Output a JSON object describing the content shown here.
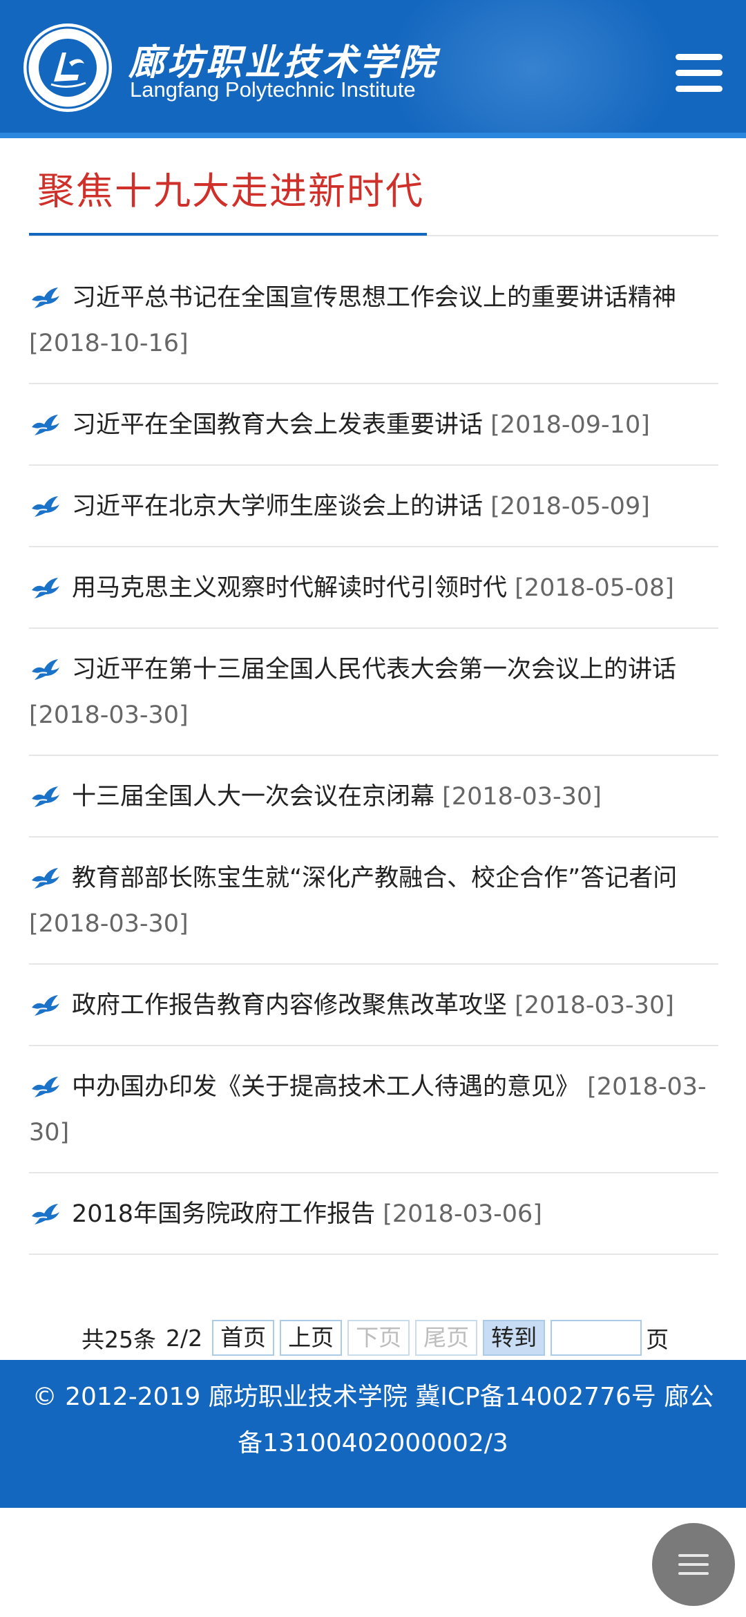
{
  "header": {
    "logo_cn": "廊坊职业技术学院",
    "logo_en": "Langfang Polytechnic Institute",
    "seal_text": "廊坊职业技术学院 Langfang Polytechnic Institute",
    "menu_icon": "hamburger-menu-icon"
  },
  "section": {
    "title": "聚焦十九大走进新时代"
  },
  "news": [
    {
      "title": "习近平总书记在全国宣传思想工作会议上的重要讲话精神",
      "date": "[2018-10-16]"
    },
    {
      "title": "习近平在全国教育大会上发表重要讲话",
      "date": "[2018-09-10]"
    },
    {
      "title": "习近平在北京大学师生座谈会上的讲话",
      "date": "[2018-05-09]"
    },
    {
      "title": "用马克思主义观察时代解读时代引领时代",
      "date": "[2018-05-08]"
    },
    {
      "title": "习近平在第十三届全国人民代表大会第一次会议上的讲话",
      "date": "[2018-03-30]"
    },
    {
      "title": "十三届全国人大一次会议在京闭幕",
      "date": "[2018-03-30]"
    },
    {
      "title": "教育部部长陈宝生就“深化产教融合、校企合作”答记者问",
      "date": "[2018-03-30]"
    },
    {
      "title": "政府工作报告教育内容修改聚焦改革攻坚",
      "date": "[2018-03-30]"
    },
    {
      "title": "中办国办印发《关于提高技术工人待遇的意见》",
      "date": "[2018-03-30]"
    },
    {
      "title": "2018年国务院政府工作报告",
      "date": "[2018-03-06]"
    }
  ],
  "pager": {
    "total": "共25条",
    "page": "2/2",
    "first": "首页",
    "prev": "上页",
    "next": "下页",
    "last": "尾页",
    "go": "转到",
    "input_value": "",
    "page_suffix": "页"
  },
  "footer": {
    "text": "© 2012-2019 廊坊职业技术学院 冀ICP备14002776号 廊公备13100402000002/3"
  },
  "colors": {
    "brand_blue": "#1467bf",
    "title_red": "#d0302a",
    "date_gray": "#666666",
    "bullet_blue": "#1a73c9"
  },
  "fab": {
    "icon": "floating-menu-icon"
  }
}
